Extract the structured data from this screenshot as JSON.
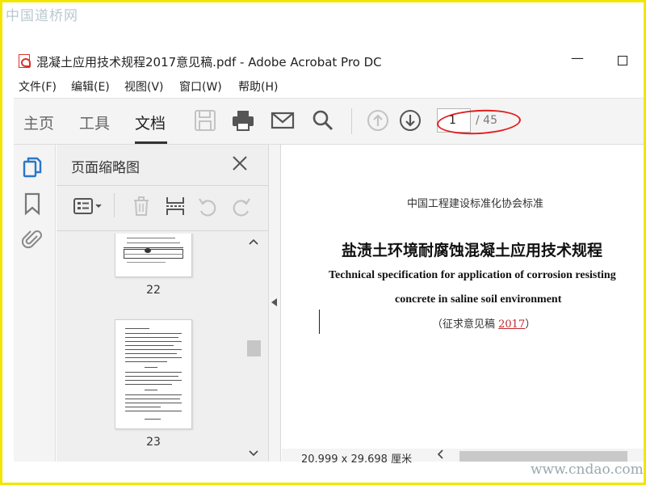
{
  "watermark": {
    "top_left": "中国道桥网",
    "bottom_right": "www.cndao.com"
  },
  "window": {
    "title": "混凝土应用技术规程2017意见稿.pdf - Adobe Acrobat Pro DC",
    "minimize_glyph": "—"
  },
  "menu": [
    {
      "label": "文件(F)"
    },
    {
      "label": "编辑(E)"
    },
    {
      "label": "视图(V)"
    },
    {
      "label": "窗口(W)"
    },
    {
      "label": "帮助(H)"
    }
  ],
  "toolbar": {
    "tabs": [
      {
        "label": "主页"
      },
      {
        "label": "工具"
      },
      {
        "label": "文档"
      }
    ],
    "active_tab": "文档",
    "page_current": "1",
    "page_total": "/ 45",
    "icons": [
      "save-icon",
      "print-icon",
      "email-icon",
      "search-icon",
      "page-up-icon",
      "page-down-icon"
    ],
    "highlight_color": "#e21f1f"
  },
  "sidebar": {
    "panel_title": "页面缩略图",
    "thumbnails": [
      {
        "page_label": "22"
      },
      {
        "page_label": "23"
      }
    ]
  },
  "document": {
    "org_line": "中国工程建设标准化协会标准",
    "title_cn": "盐渍土环境耐腐蚀混凝土应用技术规程",
    "title_en_line1": "Technical specification for application of corrosion resisting",
    "title_en_line2": "concrete in saline soil environment",
    "subtitle_prefix": "（征求意见稿 ",
    "subtitle_year": "2017",
    "subtitle_suffix": "）"
  },
  "status": {
    "page_size": "20.999 x 29.698 厘米"
  },
  "colors": {
    "accent_blue": "#2a76c7",
    "toolbar_bg": "#f4f4f4",
    "panel_bg": "#efefef"
  }
}
